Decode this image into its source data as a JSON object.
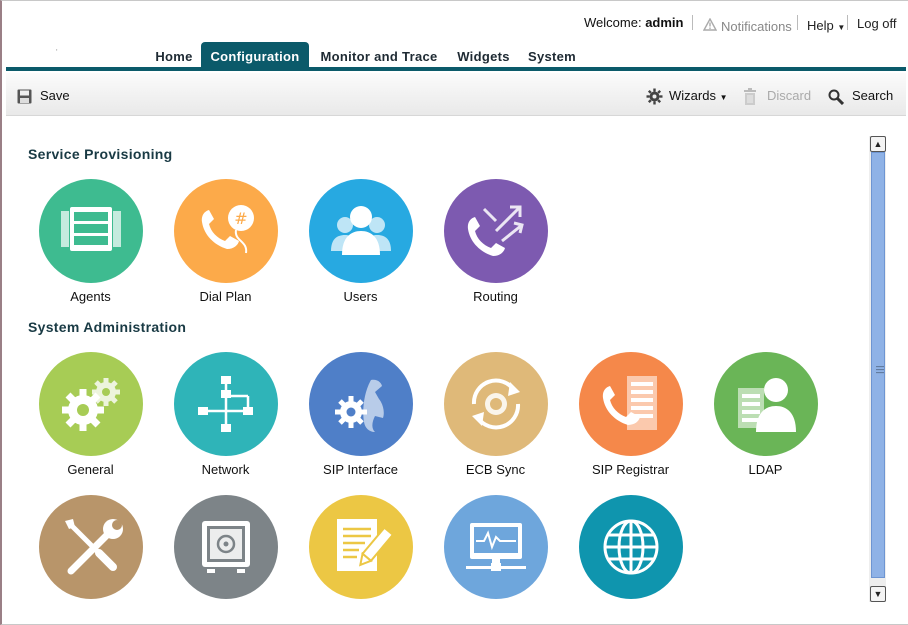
{
  "header": {
    "welcome_prefix": "Welcome:",
    "username": "admin",
    "notifications": "Notifications",
    "help": "Help",
    "logoff": "Log off"
  },
  "nav": {
    "tabs": [
      {
        "label": "Home"
      },
      {
        "label": "Configuration",
        "active": true
      },
      {
        "label": "Monitor and Trace"
      },
      {
        "label": "Widgets"
      },
      {
        "label": "System"
      }
    ]
  },
  "toolbar": {
    "save": "Save",
    "wizards": "Wizards",
    "discard": "Discard",
    "search": "Search"
  },
  "sections": {
    "service_provisioning": {
      "title": "Service Provisioning",
      "tiles": [
        {
          "label": "Agents",
          "icon": "agents-icon",
          "color": "#3ebb90"
        },
        {
          "label": "Dial Plan",
          "icon": "dial-plan-icon",
          "color": "#fcaa4a"
        },
        {
          "label": "Users",
          "icon": "users-icon",
          "color": "#27a9e1"
        },
        {
          "label": "Routing",
          "icon": "routing-icon",
          "color": "#7d5ab0"
        }
      ]
    },
    "system_administration": {
      "title": "System Administration",
      "tiles": [
        {
          "label": "General",
          "icon": "gears-icon",
          "color": "#a7cc55"
        },
        {
          "label": "Network",
          "icon": "network-icon",
          "color": "#2fb4b8"
        },
        {
          "label": "SIP Interface",
          "icon": "sip-interface-icon",
          "color": "#4f7fc8"
        },
        {
          "label": "ECB Sync",
          "icon": "sync-icon",
          "color": "#dfb979"
        },
        {
          "label": "SIP Registrar",
          "icon": "sip-registrar-icon",
          "color": "#f5884a"
        },
        {
          "label": "LDAP",
          "icon": "ldap-icon",
          "color": "#6ab557"
        },
        {
          "label": "",
          "icon": "tools-icon",
          "color": "#b8956a"
        },
        {
          "label": "",
          "icon": "safe-icon",
          "color": "#7d8488"
        },
        {
          "label": "",
          "icon": "document-edit-icon",
          "color": "#ecc744"
        },
        {
          "label": "",
          "icon": "monitor-icon",
          "color": "#6ea6dc"
        },
        {
          "label": "",
          "icon": "globe-icon",
          "color": "#0f95ae"
        }
      ]
    }
  }
}
